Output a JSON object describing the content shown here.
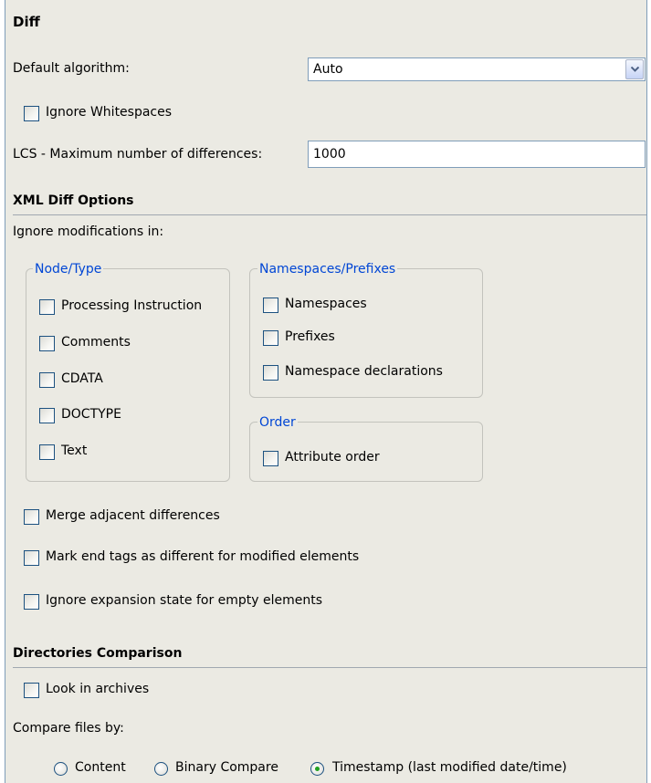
{
  "diff": {
    "title": "Diff",
    "default_algorithm_label": "Default algorithm:",
    "default_algorithm_value": "Auto",
    "ignore_whitespaces": {
      "label": "Ignore Whitespaces",
      "checked": false
    },
    "lcs_label": "LCS - Maximum number of differences:",
    "lcs_value": "1000"
  },
  "xml_diff": {
    "title": "XML Diff Options",
    "ignore_label": "Ignore modifications in:",
    "node_type": {
      "legend": "Node/Type",
      "items": [
        {
          "label": "Processing Instruction",
          "checked": false
        },
        {
          "label": "Comments",
          "checked": false
        },
        {
          "label": "CDATA",
          "checked": false
        },
        {
          "label": "DOCTYPE",
          "checked": false
        },
        {
          "label": "Text",
          "checked": false
        }
      ]
    },
    "namespaces": {
      "legend": "Namespaces/Prefixes",
      "items": [
        {
          "label": "Namespaces",
          "checked": false
        },
        {
          "label": "Prefixes",
          "checked": false
        },
        {
          "label": "Namespace declarations",
          "checked": false
        }
      ]
    },
    "order": {
      "legend": "Order",
      "items": [
        {
          "label": "Attribute order",
          "checked": false
        }
      ]
    },
    "merge_adjacent": {
      "label": "Merge adjacent differences",
      "checked": false
    },
    "mark_end_tags": {
      "label": "Mark end tags as different for modified elements",
      "checked": false
    },
    "ignore_expansion": {
      "label": "Ignore expansion state for empty elements",
      "checked": false
    }
  },
  "directories": {
    "title": "Directories Comparison",
    "look_in_archives": {
      "label": "Look in archives",
      "checked": false
    },
    "compare_by_label": "Compare files by:",
    "compare_options": [
      {
        "label": "Content",
        "selected": false
      },
      {
        "label": "Binary Compare",
        "selected": false
      },
      {
        "label": "Timestamp (last modified date/time)",
        "selected": true
      }
    ]
  },
  "colors": {
    "panel_bg": "#ebeae3",
    "group_legend": "#0046d5",
    "radio_selected": "#21a121"
  }
}
